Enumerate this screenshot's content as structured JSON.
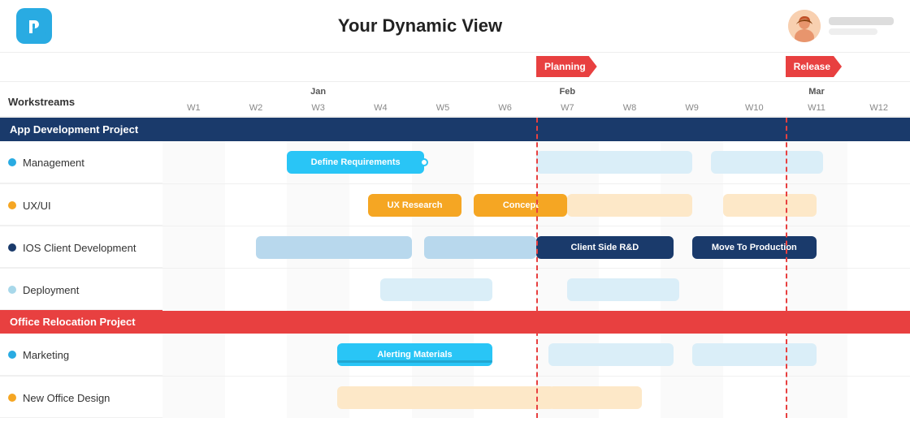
{
  "header": {
    "title": "Your Dynamic View",
    "logo_letter": "P"
  },
  "milestones": [
    {
      "label": "Planning",
      "week_index": 6,
      "color": "red"
    },
    {
      "label": "Release",
      "week_index": 10,
      "color": "red"
    }
  ],
  "weeks": [
    {
      "label": "W1",
      "month": ""
    },
    {
      "label": "W2",
      "month": ""
    },
    {
      "label": "W3",
      "month": "Jan"
    },
    {
      "label": "W4",
      "month": ""
    },
    {
      "label": "W5",
      "month": ""
    },
    {
      "label": "W6",
      "month": ""
    },
    {
      "label": "W7",
      "month": "Feb"
    },
    {
      "label": "W8",
      "month": ""
    },
    {
      "label": "W9",
      "month": ""
    },
    {
      "label": "W10",
      "month": ""
    },
    {
      "label": "W11",
      "month": "Mar"
    },
    {
      "label": "W12",
      "month": ""
    }
  ],
  "sections": [
    {
      "title": "App Development Project",
      "color": "dark-blue",
      "rows": [
        {
          "name": "Management",
          "dot": "blue",
          "bars": [
            {
              "start": 2,
              "span": 2.2,
              "label": "Define Requirements",
              "style": "cyan"
            },
            {
              "start": 6,
              "span": 2.5,
              "label": "",
              "style": "blue-light"
            },
            {
              "start": 8.8,
              "span": 1.8,
              "label": "",
              "style": "blue-light"
            }
          ]
        },
        {
          "name": "UX/UI",
          "dot": "orange",
          "bars": [
            {
              "start": 3.3,
              "span": 1.5,
              "label": "UX Research",
              "style": "orange"
            },
            {
              "start": 5,
              "span": 1.5,
              "label": "Concept",
              "style": "orange"
            },
            {
              "start": 6.5,
              "span": 2,
              "label": "",
              "style": "orange-light"
            },
            {
              "start": 9,
              "span": 1.5,
              "label": "",
              "style": "orange-light"
            }
          ]
        },
        {
          "name": "IOS Client Development",
          "dot": "dark",
          "bars": [
            {
              "start": 1.5,
              "span": 2.5,
              "label": "",
              "style": "blue-mid"
            },
            {
              "start": 4.2,
              "span": 1.8,
              "label": "",
              "style": "blue-mid"
            },
            {
              "start": 6,
              "span": 2.2,
              "label": "Client Side R&D",
              "style": "dark-blue"
            },
            {
              "start": 8.5,
              "span": 2,
              "label": "Move To Production",
              "style": "dark-blue"
            }
          ]
        },
        {
          "name": "Deployment",
          "dot": "light",
          "bars": [
            {
              "start": 3.5,
              "span": 1.8,
              "label": "",
              "style": "blue-light"
            },
            {
              "start": 6.5,
              "span": 1.8,
              "label": "",
              "style": "blue-light"
            }
          ]
        }
      ]
    },
    {
      "title": "Office Relocation Project",
      "color": "red",
      "rows": [
        {
          "name": "Marketing",
          "dot": "blue",
          "bars": [
            {
              "start": 2.8,
              "span": 2.5,
              "label": "Alerting Materials",
              "style": "cyan"
            },
            {
              "start": 6.2,
              "span": 2,
              "label": "",
              "style": "blue-light"
            },
            {
              "start": 8.5,
              "span": 2,
              "label": "",
              "style": "blue-light"
            }
          ]
        },
        {
          "name": "New Office Design",
          "dot": "orange",
          "bars": [
            {
              "start": 2.8,
              "span": 3.5,
              "label": "",
              "style": "orange-light"
            },
            {
              "start": 6.2,
              "span": 1.5,
              "label": "",
              "style": "orange-light"
            }
          ]
        }
      ]
    }
  ],
  "labels": {
    "workstreams": "Workstreams"
  }
}
